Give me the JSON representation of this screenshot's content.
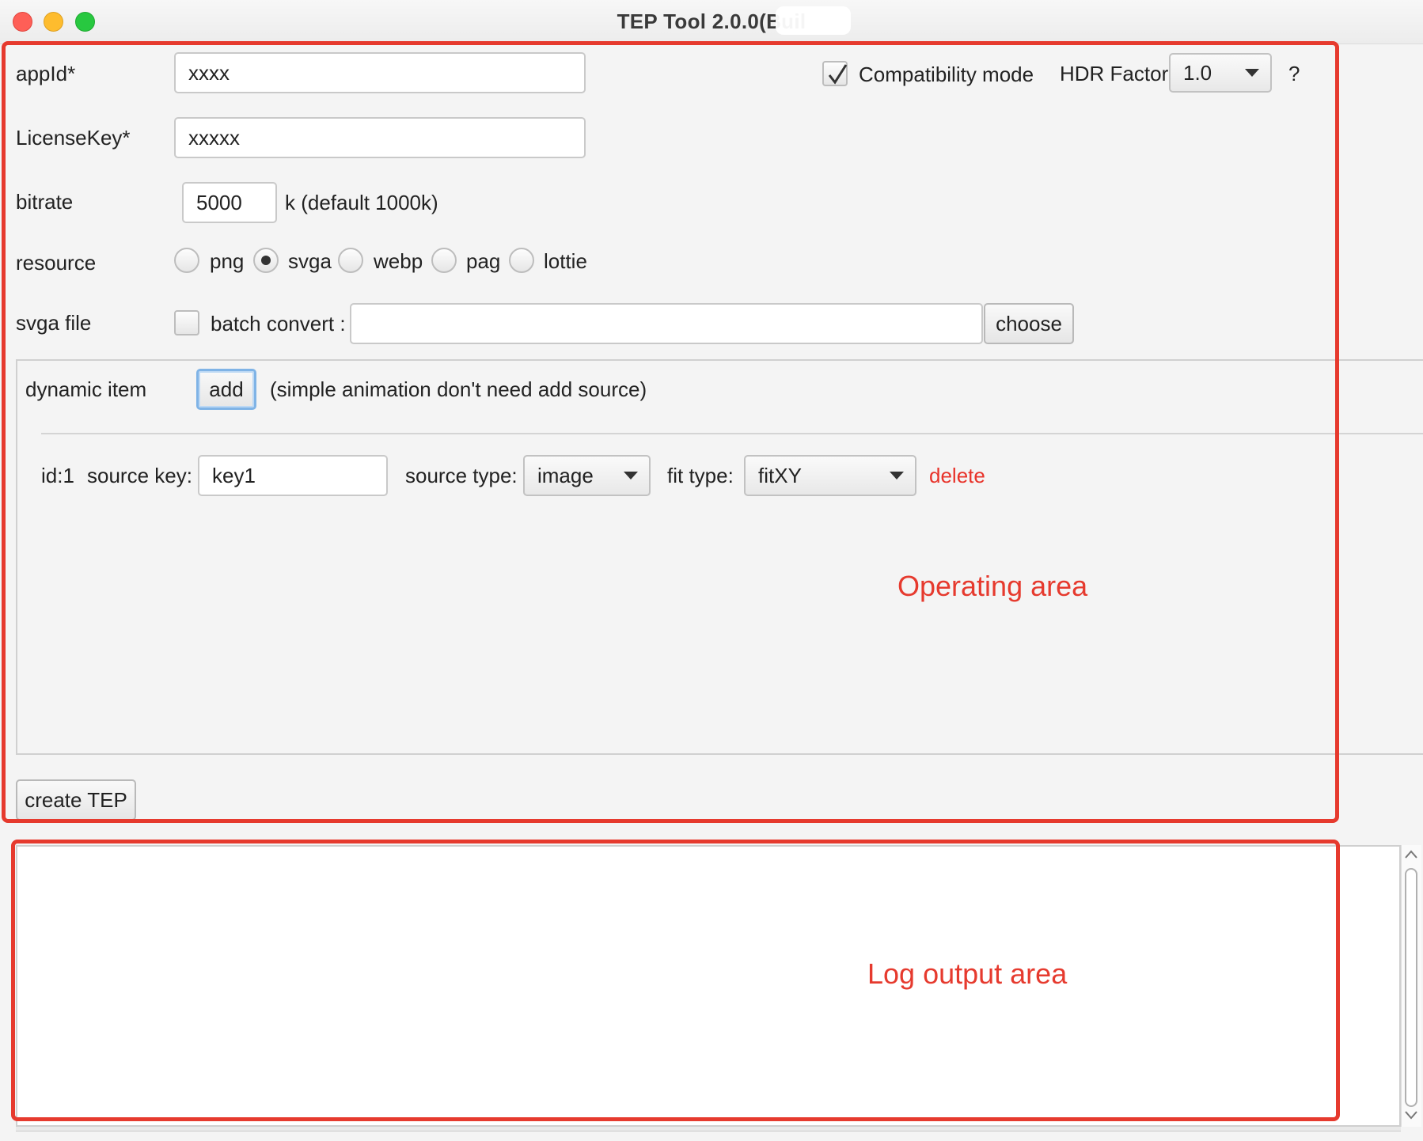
{
  "window": {
    "title": "TEP Tool 2.0.0(Buil"
  },
  "form": {
    "appid_label": "appId*",
    "appid_value": "xxxx",
    "licensekey_label": "LicenseKey*",
    "licensekey_value": "xxxxx",
    "bitrate_label": "bitrate",
    "bitrate_value": "5000",
    "bitrate_hint": "k (default 1000k)",
    "resource_label": "resource",
    "resource_options": [
      {
        "label": "png",
        "checked": false
      },
      {
        "label": "svga",
        "checked": true
      },
      {
        "label": "webp",
        "checked": false
      },
      {
        "label": "pag",
        "checked": false
      },
      {
        "label": "lottie",
        "checked": false
      }
    ],
    "svga_file_label": "svga file",
    "batch_convert_label": "batch convert :",
    "batch_convert_checked": false,
    "file_path_value": "",
    "choose_button": "choose"
  },
  "options": {
    "compat_checked": true,
    "compat_label": "Compatibility mode",
    "hdr_label": "HDR Factor:",
    "hdr_value": "1.0",
    "help_label": "?"
  },
  "dynamic": {
    "label": "dynamic item",
    "add_button": "add",
    "hint": "(simple animation don't need add source)",
    "items": [
      {
        "id_label": "id:1",
        "source_key_label": "source key:",
        "source_key_value": "key1",
        "source_type_label": "source type:",
        "source_type_value": "image",
        "fit_type_label": "fit type:",
        "fit_type_value": "fitXY",
        "delete_label": "delete"
      }
    ]
  },
  "actions": {
    "create_button": "create TEP"
  },
  "log": {
    "text": ""
  },
  "annotations": {
    "operating_area": "Operating area",
    "log_output_area": "Log output area",
    "color": "#e63a2e"
  }
}
